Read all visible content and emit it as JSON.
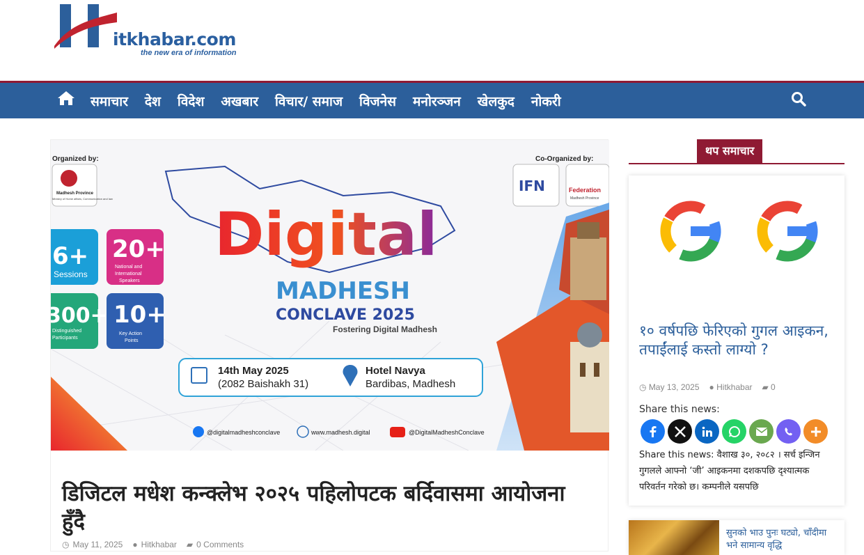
{
  "site": {
    "logo_text": "itkhabar.com",
    "logo_tagline": "the new era of information"
  },
  "nav": {
    "items": [
      "समाचार",
      "देश",
      "विदेश",
      "अखबार",
      "विचार/ समाज",
      "विजनेस",
      "मनोरञ्जन",
      "खेलकुद",
      "नोकरी"
    ],
    "home_icon": "home-icon",
    "search_icon": "search-icon"
  },
  "hero": {
    "organized_by": "Organized by:",
    "co_organized_by": "Co-Organized by:",
    "org_name": "Madhesh Province",
    "org_sub": "Ministry of Home affairs, Communication and law",
    "ifn": "IFN",
    "fed": "Federation",
    "fed_sub": "Madhesh Province",
    "headline": "Digital",
    "madhesh": "MADHESH",
    "conclave": "CONCLAVE 2025",
    "fostering": "Fostering Digital Madhesh",
    "stats": [
      {
        "num": "6+",
        "label": "Sessions"
      },
      {
        "num": "20+",
        "label": "National and International Speakers"
      },
      {
        "num": "300+",
        "label": "Distinguished Participants"
      },
      {
        "num": "10+",
        "label": "Key Action Points"
      }
    ],
    "date_line1": "14th May 2025",
    "date_line2": "(2082 Baishakh 31)",
    "venue_line1": "Hotel Navya",
    "venue_line2": "Bardibas, Madhesh",
    "social_fb": "@digitalmadheshconclave",
    "social_web": "www.madhesh.digital",
    "social_yt": "@DigitalMadheshConclave"
  },
  "article": {
    "title": "डिजिटल मधेश कन्क्लेभ २०२५ पहिलोपटक बर्दिवासमा आयोजना हुँदै",
    "date": "May 11, 2025",
    "author": "Hitkhabar",
    "comments": "0 Comments"
  },
  "sidebar": {
    "heading": "थप समाचार",
    "card": {
      "title": "१० वर्षपछि फेरिएको गुगल आइकन, तपाईंलाई कस्तो लाग्यो ?",
      "date": "May 13, 2025",
      "author": "Hitkhabar",
      "comments": "0",
      "share_label": "Share this news:",
      "share_buttons": [
        {
          "name": "facebook",
          "color": "#1877f2"
        },
        {
          "name": "x",
          "color": "#000000"
        },
        {
          "name": "linkedin",
          "color": "#0a66c2"
        },
        {
          "name": "whatsapp",
          "color": "#25d366"
        },
        {
          "name": "email",
          "color": "#6aa84f"
        },
        {
          "name": "viber",
          "color": "#7360f2"
        },
        {
          "name": "more",
          "color": "#f28c28"
        }
      ],
      "excerpt": "Share this news: वैशाख ३०, २०८२ । सर्च इन्जिन गुगलले आफ्नो ‘जी’ आइकनमा दशकपछि दृश्यात्मक परिवर्तन गरेको छ। कम्पनीले यसपछि"
    },
    "mini": {
      "title": "सुनको भाउ पुनः घट्यो, चाँदीमा भने सामान्य वृद्धि"
    }
  }
}
